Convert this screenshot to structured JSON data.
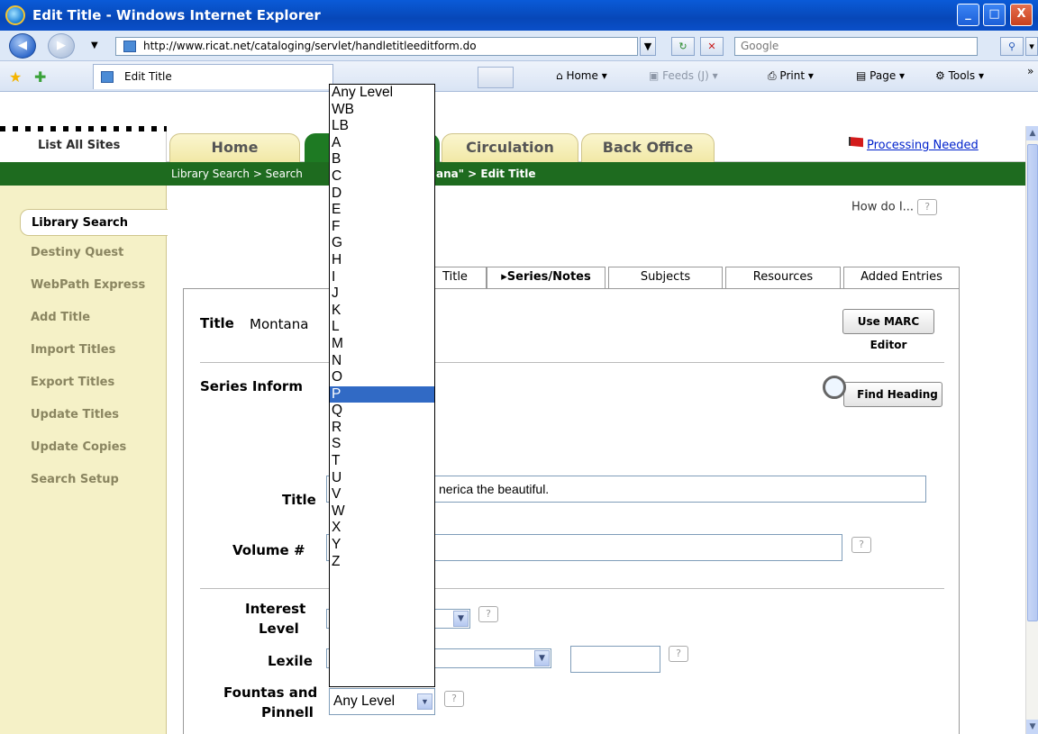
{
  "window": {
    "title": "Edit Title - Windows Internet Explorer",
    "minimize": "_",
    "maximize": "□",
    "close": "X"
  },
  "addressbar": {
    "url": "http://www.ricat.net/cataloging/servlet/handletitleeditform.do",
    "search_placeholder": "Google"
  },
  "commandbar": {
    "tab_title": "Edit Title",
    "home": "Home",
    "feeds": "Feeds (J)",
    "print": "Print",
    "page": "Page",
    "tools": "Tools",
    "more": "»"
  },
  "app": {
    "list_all_sites": "List All Sites",
    "tabs": [
      {
        "label": "Home"
      },
      {
        "label": ""
      },
      {
        "label": "Circulation"
      },
      {
        "label": "Back Office"
      }
    ],
    "processing_needed": "Processing Needed",
    "breadcrumb_left": "Library Search > Search",
    "breadcrumb_right": "ana\" > Edit Title"
  },
  "sidebar": {
    "items": [
      {
        "label": "Library Search"
      },
      {
        "label": "Destiny Quest"
      },
      {
        "label": "WebPath Express"
      },
      {
        "label": "Add Title"
      },
      {
        "label": "Import Titles"
      },
      {
        "label": "Export Titles"
      },
      {
        "label": "Update Titles"
      },
      {
        "label": "Update Copies"
      },
      {
        "label": "Search Setup"
      }
    ]
  },
  "main": {
    "how_do_i": "How do I...",
    "help": "?",
    "subtabs": [
      {
        "label": "Title"
      },
      {
        "label": "Series/Notes"
      },
      {
        "label": "Subjects"
      },
      {
        "label": "Resources"
      },
      {
        "label": "Added Entries"
      }
    ],
    "title_label": "Title",
    "title_value": "Montana",
    "use_marc_editor": "Use MARC Editor",
    "series_information": "Series Inform",
    "find_heading": "Find Heading",
    "series_title_label": "Title",
    "series_title_value": "nerica the beautiful.",
    "volume_label": "Volume #",
    "volume_value": "",
    "interest_level_label_1": "Interest",
    "interest_level_label_2": "Level",
    "lexile_label": "Lexile",
    "lexile_value": "",
    "fountas_label_1": "Fountas and",
    "fountas_label_2": "Pinnell",
    "fountas_selected": "Any Level"
  },
  "dropdown": {
    "options": [
      "Any Level",
      "WB",
      "LB",
      "A",
      "B",
      "C",
      "D",
      "E",
      "F",
      "G",
      "H",
      "I",
      "J",
      "K",
      "L",
      "M",
      "N",
      "O",
      "P",
      "Q",
      "R",
      "S",
      "T",
      "U",
      "V",
      "W",
      "X",
      "Y",
      "Z"
    ],
    "highlighted": "P"
  }
}
